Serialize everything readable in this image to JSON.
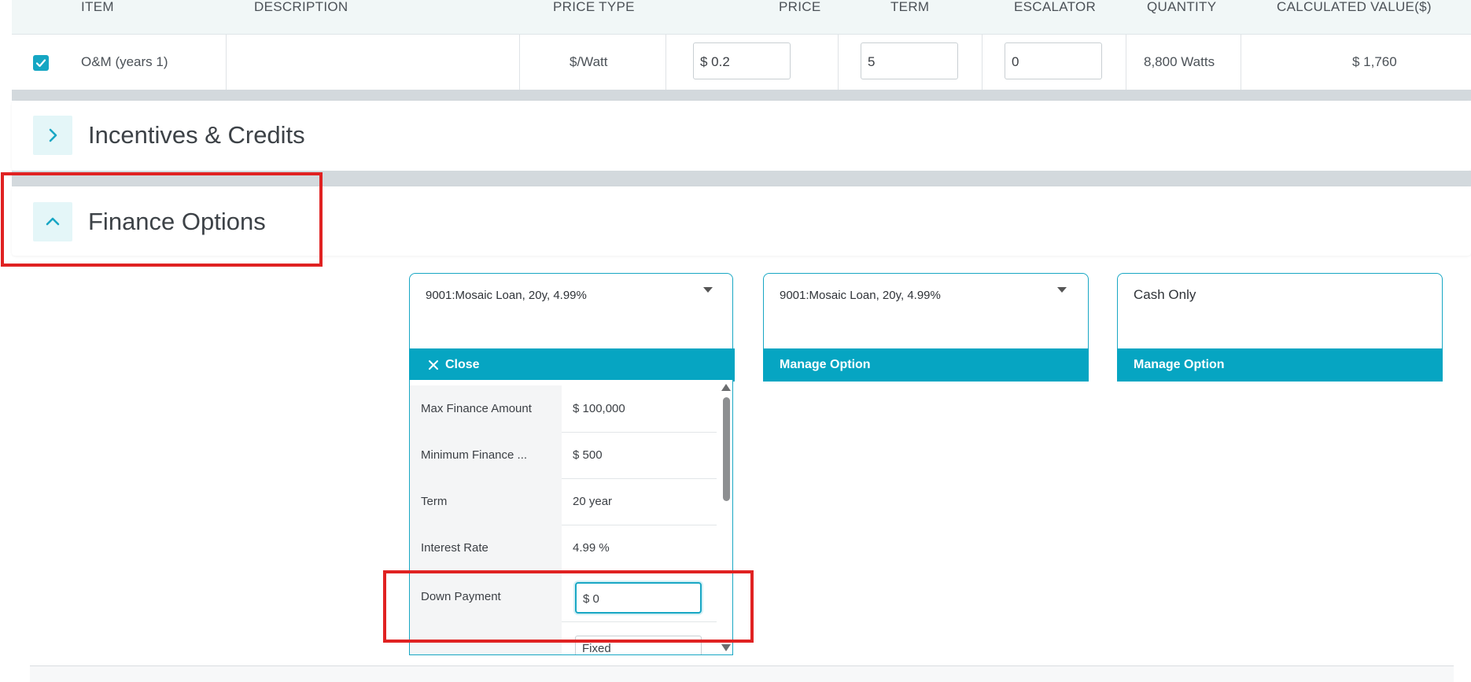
{
  "table": {
    "headers": {
      "item": "ITEM",
      "description": "DESCRIPTION",
      "price_type": "PRICE TYPE",
      "price": "PRICE",
      "term": "TERM",
      "escalator": "ESCALATOR",
      "quantity": "QUANTITY",
      "calculated_value": "CALCULATED VALUE($)"
    },
    "row": {
      "checked": true,
      "item": "O&M (years 1)",
      "description": "",
      "price_type": "$/Watt",
      "price": "$ 0.2",
      "term": "5",
      "escalator": "0",
      "quantity": "8,800 Watts",
      "calculated_value": "$ 1,760"
    }
  },
  "sections": {
    "incentives": {
      "title": "Incentives & Credits",
      "icon": "chevron-right-icon"
    },
    "finance": {
      "title": "Finance Options",
      "icon": "chevron-up-icon"
    }
  },
  "cards": [
    {
      "title": "9001:Mosaic Loan, 20y, 4.99%",
      "bar_label": "Close",
      "bar_icon": "close-icon",
      "has_dropdown": true
    },
    {
      "title": "9001:Mosaic Loan, 20y, 4.99%",
      "bar_label": "Manage Option",
      "has_dropdown": true
    },
    {
      "title": "Cash Only",
      "bar_label": "Manage Option",
      "has_dropdown": false
    }
  ],
  "finance_details": {
    "max_finance_amount": {
      "label": "Max Finance Amount",
      "value": "$ 100,000"
    },
    "minimum_finance": {
      "label": "Minimum Finance ...",
      "value": "$ 500"
    },
    "term": {
      "label": "Term",
      "value": "20 year"
    },
    "interest_rate": {
      "label": "Interest Rate",
      "value": "4.99 %"
    },
    "down_payment": {
      "label": "Down Payment",
      "value": "$ 0"
    },
    "next_select_value": "Fixed"
  },
  "colors": {
    "accent": "#06a5c2",
    "highlight_border": "#e02222",
    "band_gray": "#d3d9dd"
  }
}
